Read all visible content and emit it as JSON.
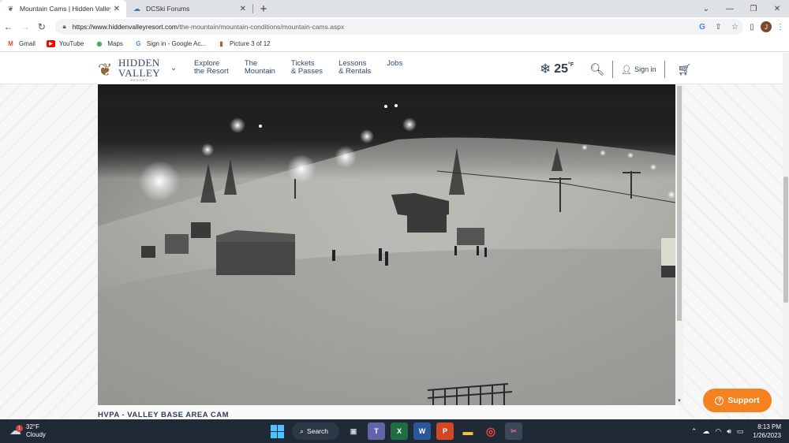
{
  "browser": {
    "tabs": [
      {
        "title": "Mountain Cams | Hidden Valley",
        "active": true,
        "favicon": "hidden-valley-icon"
      },
      {
        "title": "DCSki Forums",
        "active": false,
        "favicon": "dcski-icon"
      }
    ],
    "new_tab": "+",
    "url_host": "https://www.hiddenvalleyresort.com",
    "url_path": "/the-mountain/mountain-conditions/mountain-cams.aspx",
    "profile_initial": "J",
    "bookmarks": [
      {
        "label": "Gmail",
        "icon": "M",
        "color": "#ea4335"
      },
      {
        "label": "YouTube",
        "icon": "▶",
        "color": "#ff0000"
      },
      {
        "label": "Maps",
        "icon": "◉",
        "color": "#34a853"
      },
      {
        "label": "Sign in - Google Ac...",
        "icon": "G",
        "color": "#4285f4"
      },
      {
        "label": "Picture 3 of 12",
        "icon": "▮",
        "color": "#9c6b2f"
      }
    ]
  },
  "site": {
    "logo": {
      "line1": "HIDDEN",
      "line2": "VALLEY",
      "line3": "RESORT"
    },
    "nav": [
      {
        "line1": "Explore",
        "line2": "the Resort"
      },
      {
        "line1": "The",
        "line2": "Mountain"
      },
      {
        "line1": "Tickets",
        "line2": "& Passes"
      },
      {
        "line1": "Lessons",
        "line2": "& Rentals"
      },
      {
        "line1": "Jobs",
        "line2": ""
      }
    ],
    "temperature": "25",
    "temperature_unit": "°F",
    "sign_in": "Sign in",
    "cam_caption": "HVPA - VALLEY BASE AREA CAM",
    "support_label": "Support"
  },
  "taskbar": {
    "weather_temp": "32°F",
    "weather_desc": "Cloudy",
    "weather_badge": "1",
    "search_label": "Search",
    "apps": [
      {
        "name": "task-view",
        "glyph": "▣",
        "color": "#9aa4ae"
      },
      {
        "name": "teams",
        "glyph": "T",
        "color": "#6264a7"
      },
      {
        "name": "excel",
        "glyph": "X",
        "color": "#1d6f42"
      },
      {
        "name": "word",
        "glyph": "W",
        "color": "#2b579a"
      },
      {
        "name": "powerpoint",
        "glyph": "P",
        "color": "#d24726"
      },
      {
        "name": "file-explorer",
        "glyph": "▬",
        "color": "#f3c240"
      },
      {
        "name": "chrome",
        "glyph": "◎",
        "color": "#e8453c"
      },
      {
        "name": "snipping-tool",
        "glyph": "✂",
        "color": "#c2185b"
      }
    ],
    "time": "8:13 PM",
    "date": "1/26/2023"
  }
}
